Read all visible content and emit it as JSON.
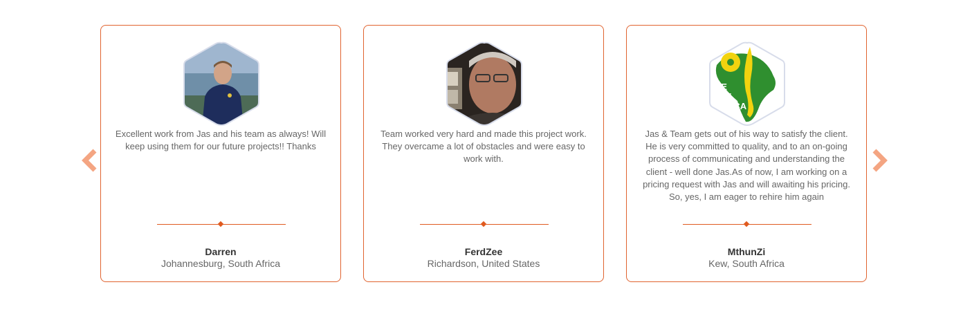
{
  "colors": {
    "accent": "#e0622e",
    "arrow": "#f4a582",
    "text": "#666666",
    "name": "#333333",
    "hex_border": "#d7dcea"
  },
  "carousel": {
    "prev_icon": "chevron-left-icon",
    "next_icon": "chevron-right-icon"
  },
  "testimonials": [
    {
      "quote": "Excellent work from Jas and his team as always! Will keep using them for our future projects!! Thanks",
      "name": "Darren",
      "location": "Johannesburg, South Africa"
    },
    {
      "quote": "Team worked very hard and made this project work. They overcame a lot of obstacles and were easy to work with.",
      "name": "FerdZee",
      "location": "Richardson, United States"
    },
    {
      "quote": "Jas & Team gets out of his way to satisfy the client. He is very committed to quality, and to an on-going process of communicating and understanding the client - well done Jas.As of now, I am working on a pricing request with Jas and will awaiting his pricing. So, yes, I am eager to rehire him again",
      "name": "MthunZi",
      "location": "Kew, South Africa",
      "logo_text": "WE ARE AFRICA"
    }
  ]
}
